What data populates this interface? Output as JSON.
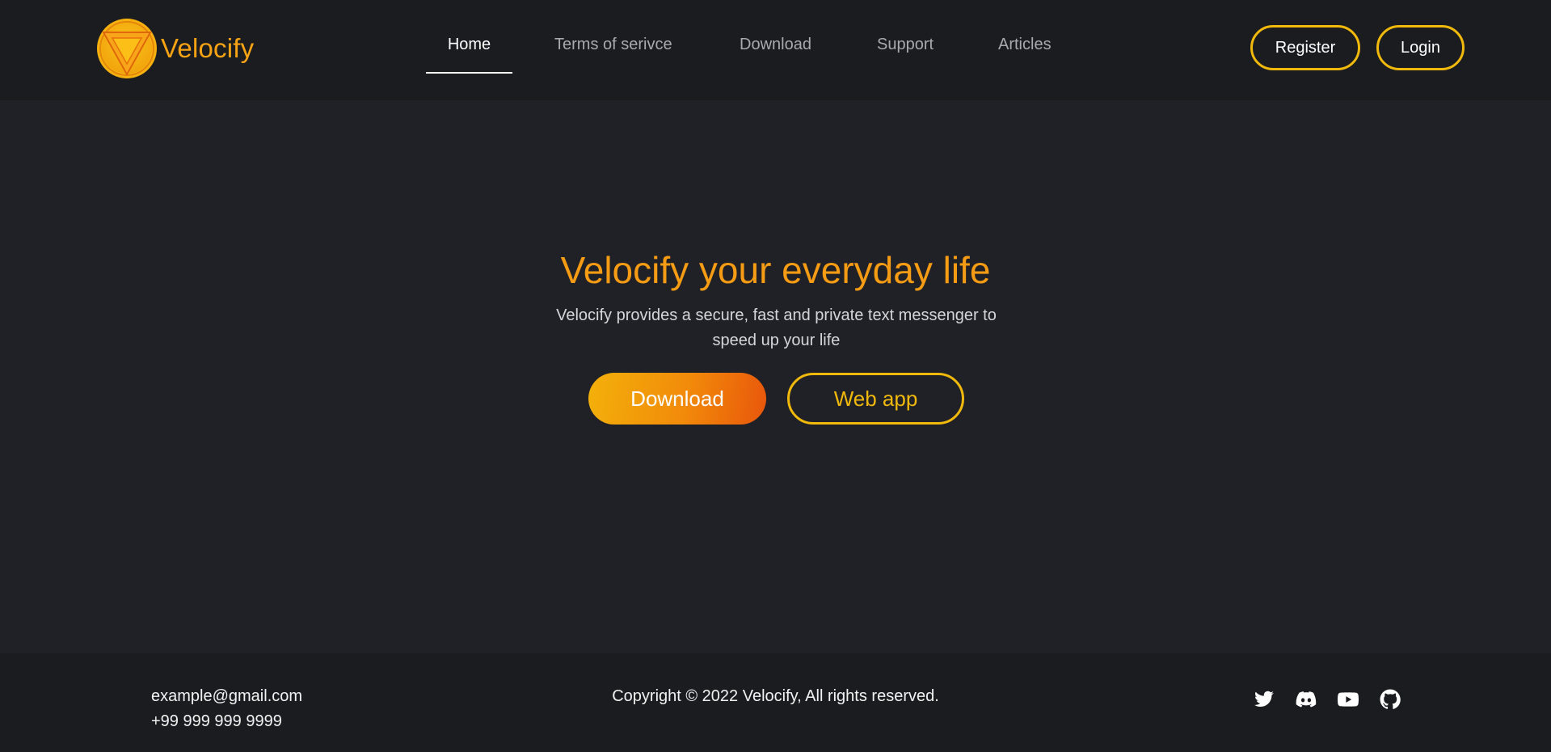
{
  "brand": {
    "name": "Velocify",
    "accent_color": "#f59b14",
    "border_color": "#f0b90b"
  },
  "nav": {
    "links": [
      "Home",
      "Terms of serivce",
      "Download",
      "Support",
      "Articles"
    ],
    "active": "Home"
  },
  "header_buttons": {
    "register": "Register",
    "login": "Login"
  },
  "hero": {
    "title": "Velocify your everyday life",
    "subtitle": "Velocify provides a secure, fast and private text messenger to speed up your life",
    "download_label": "Download",
    "webapp_label": "Web app"
  },
  "footer": {
    "email": "example@gmail.com",
    "phone": "+99 999 999 9999",
    "copyright": "Copyright © 2022 Velocify, All rights reserved.",
    "social_icons": [
      "twitter-icon",
      "discord-icon",
      "youtube-icon",
      "github-icon"
    ]
  }
}
